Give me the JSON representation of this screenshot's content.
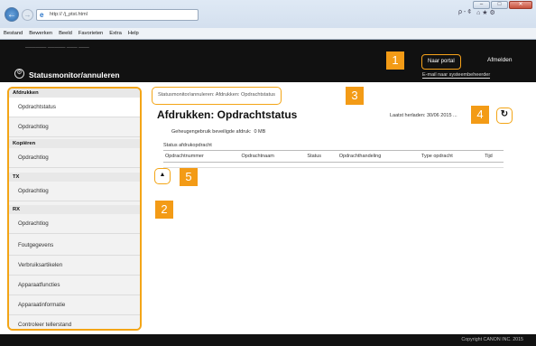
{
  "browser": {
    "address": "http://                       /j_ptst.html",
    "menu": [
      "Bestand",
      "Bewerken",
      "Beeld",
      "Favorieten",
      "Extra",
      "Help"
    ],
    "toolbar_search": "ρ - ¢",
    "toolbar_icons": "⌂ ★ ⚙"
  },
  "header": {
    "device_name": "──────  ─────  ─── ───",
    "title": "Statusmonitor/annuleren",
    "portal_button": "Naar portal",
    "logout": "Afmelden",
    "sysadmin_link": "E-mail naar systeembeheerder"
  },
  "sidebar": {
    "sections": [
      {
        "label": "Afdrukken",
        "items": [
          "Opdrachtstatus",
          "Opdrachtlog"
        ]
      },
      {
        "label": "Kopiëren",
        "items": [
          "Opdrachtlog"
        ]
      },
      {
        "label": "TX",
        "items": [
          "Opdrachtlog"
        ]
      },
      {
        "label": "RX",
        "items": [
          "Opdrachtlog"
        ]
      }
    ],
    "extra_items": [
      "Foutgegevens",
      "Verbruiksartikelen",
      "Apparaatfuncties",
      "Apparaatinformatie",
      "Controleer tellerstand"
    ]
  },
  "main": {
    "breadcrumb": "Statusmonitor/annuleren: Afdrukken: Opdrachtstatus",
    "title": "Afdrukken: Opdrachtstatus",
    "last_updated": "Laatst herladen: 30/06 2015 ...",
    "memory_label": "Geheugengebruik beveiligde afdruk:",
    "memory_value": "0 MB",
    "status_label": "Status afdrukopdracht",
    "table_headers": [
      "Opdrachtnummer",
      "Opdrachtnaam",
      "Status",
      "Opdrachthandeling",
      "Type opdracht",
      "Tijd"
    ]
  },
  "callouts": [
    "1",
    "2",
    "3",
    "4",
    "5"
  ],
  "footer": {
    "copyright": "Copyright CANON INC. 2015"
  },
  "colors": {
    "accent": "#f39b16",
    "header_bg": "#111111",
    "sidebar_bg": "#f2f2f2"
  }
}
